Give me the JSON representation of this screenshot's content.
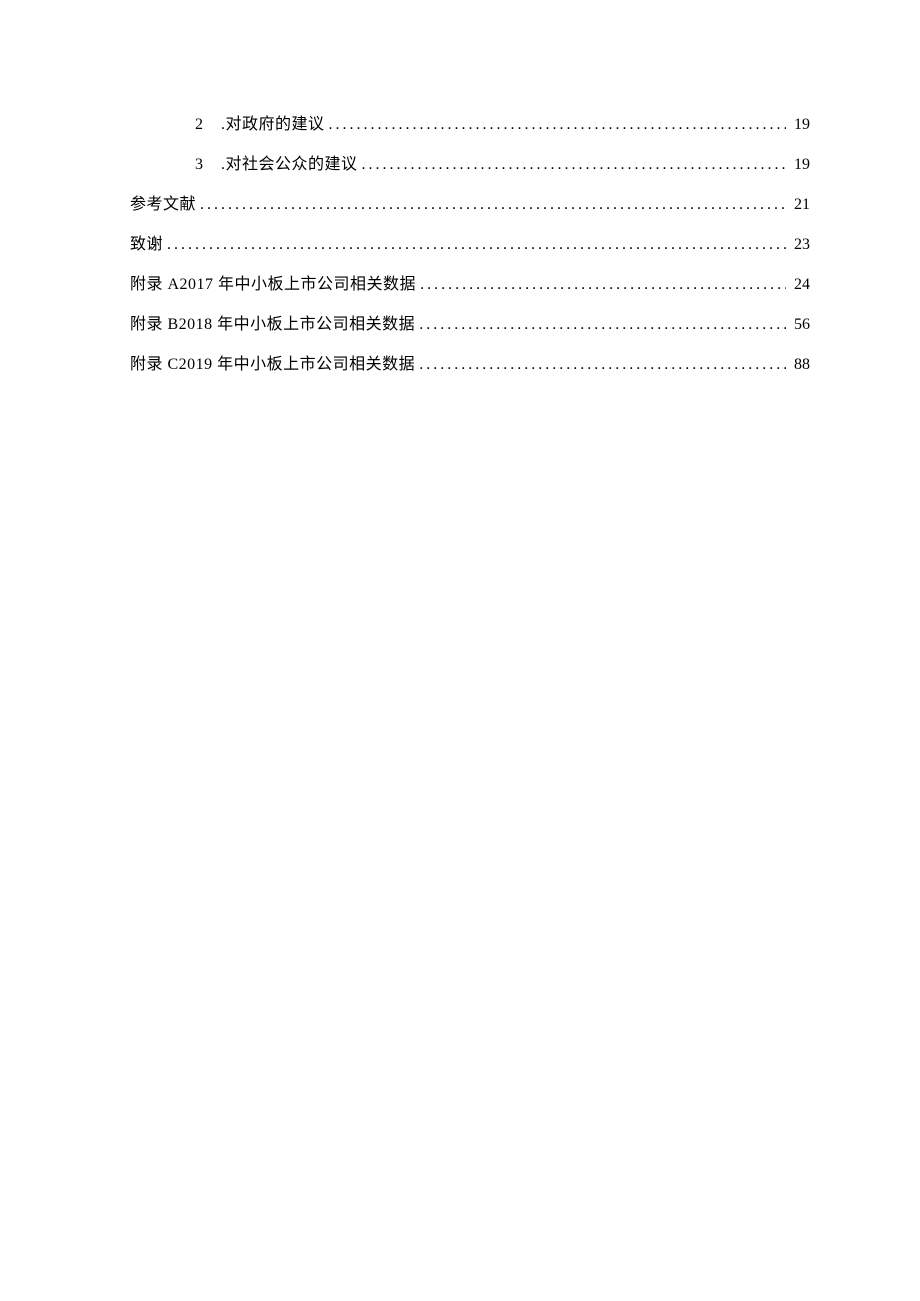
{
  "toc": [
    {
      "indent": 2,
      "num": "2",
      "text": ".对政府的建议",
      "page": "19"
    },
    {
      "indent": 2,
      "num": "3",
      "text": ".对社会公众的建议",
      "page": "19"
    },
    {
      "indent": 0,
      "num": "",
      "text": "参考文献",
      "page": "21"
    },
    {
      "indent": 0,
      "num": "",
      "text": "致谢",
      "page": "23"
    },
    {
      "indent": 0,
      "num": "",
      "text": "附录 A2017 年中小板上市公司相关数据",
      "page": "24"
    },
    {
      "indent": 0,
      "num": "",
      "text": "附录 B2018 年中小板上市公司相关数据",
      "page": "56"
    },
    {
      "indent": 0,
      "num": "",
      "text": "附录 C2019 年中小板上市公司相关数据",
      "page": "88"
    }
  ]
}
